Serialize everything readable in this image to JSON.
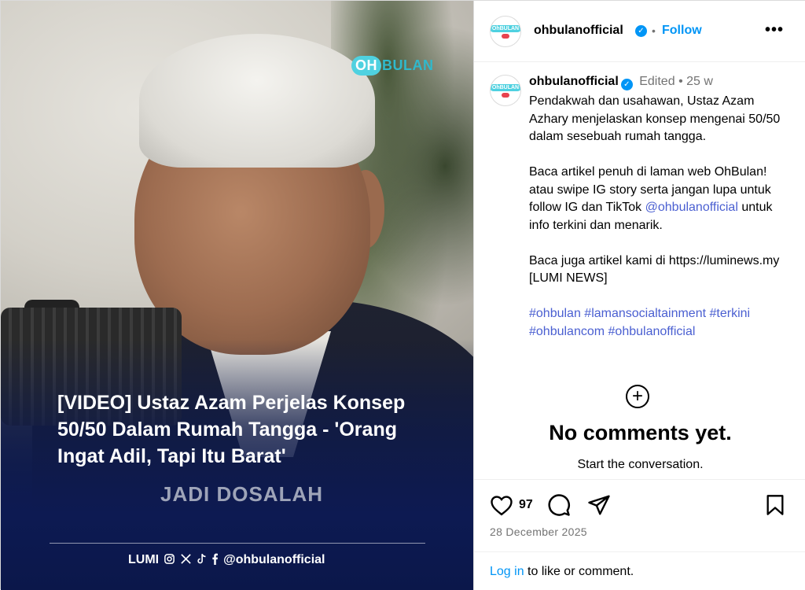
{
  "media": {
    "logo_oh": "OH",
    "logo_bulan": "BULAN",
    "headline": "[VIDEO] Ustaz Azam Perjelas Konsep 50/50 Dalam Rumah Tangga - 'Orang Ingat Adil, Tapi Itu Barat'",
    "subtitle_burn": "JADI DOSALAH",
    "footer_brand": "LUMI",
    "footer_icons": [
      "instagram-icon",
      "x-icon",
      "tiktok-icon",
      "facebook-icon"
    ],
    "footer_handle": "@ohbulanofficial"
  },
  "header": {
    "username": "ohbulanofficial",
    "separator": "•",
    "follow_label": "Follow",
    "more_label": "•••"
  },
  "caption": {
    "username": "ohbulanofficial",
    "edited": "Edited",
    "dot": "•",
    "time": "25 w",
    "p1": "Pendakwah dan usahawan, Ustaz Azam Azhary menjelaskan konsep mengenai 50/50 dalam sesebuah rumah tangga.",
    "p2_a": "Baca artikel penuh di laman web OhBulan! atau swipe IG story serta jangan lupa untuk follow IG dan TikTok",
    "p2_mention": "@ohbulanofficial",
    "p2_b": "untuk info terkini dan menarik.",
    "p3": "Baca juga artikel kami di https://luminews.my [LUMI NEWS]",
    "hashtags": [
      "#ohbulan",
      "#lamansocialtainment",
      "#terkini",
      "#ohbulancom",
      "#ohbulanofficial"
    ]
  },
  "comments": {
    "empty_title": "No comments yet.",
    "empty_sub": "Start the conversation."
  },
  "actions": {
    "like_count": "97",
    "date": "28 December 2025"
  },
  "login": {
    "link": "Log in",
    "text": "to like or comment."
  },
  "colors": {
    "accent_blue": "#0095f6",
    "link_blue": "#4a5fd1",
    "headline_bg": "#0d1a52",
    "ohbulan_cyan": "#4fd1e0"
  }
}
